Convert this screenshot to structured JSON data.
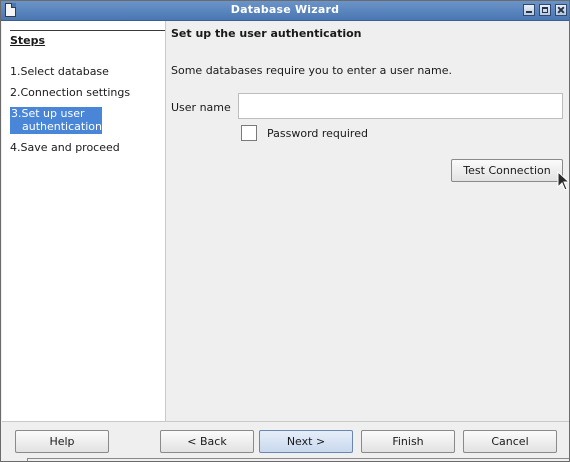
{
  "window": {
    "title": "Database Wizard"
  },
  "sidebar": {
    "title": "Steps",
    "steps": [
      {
        "number": "1.",
        "label": "Select database"
      },
      {
        "number": "2.",
        "label": "Connection settings"
      },
      {
        "number": "3.",
        "label": "Set up user authentication",
        "label_line1": "Set up user",
        "label_line2": "authentication",
        "selected": true
      },
      {
        "number": "4.",
        "label": "Save and proceed"
      }
    ]
  },
  "main": {
    "heading": "Set up the user authentication",
    "intro": "Some databases require you to enter a user name.",
    "username_label": "User name",
    "username_value": "",
    "password_required_label": "Password required",
    "password_required_checked": false,
    "test_connection_label": "Test Connection"
  },
  "footer": {
    "help_label": "Help",
    "back_label": "< Back",
    "next_label": "Next >",
    "finish_label": "Finish",
    "cancel_label": "Cancel"
  },
  "colors": {
    "titlebar": "#4a77b3",
    "selected_step": "#4a86d8"
  }
}
